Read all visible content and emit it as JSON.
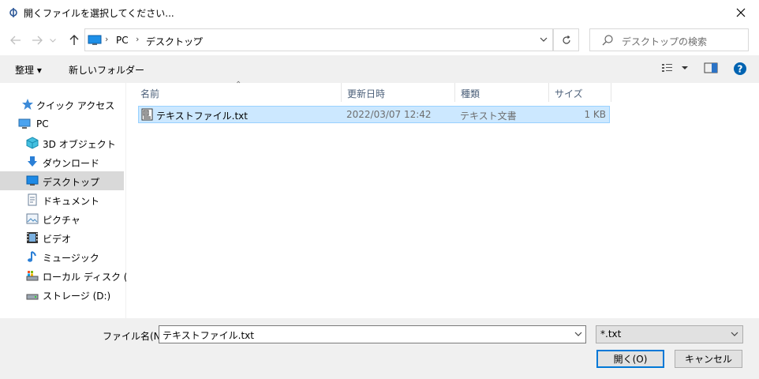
{
  "window": {
    "title": "開くファイルを選択してください..."
  },
  "address": {
    "crumbs": [
      "PC",
      "デスクトップ"
    ],
    "search_placeholder": "デスクトップの検索"
  },
  "toolbar": {
    "organize": "整理 ▾",
    "new_folder": "新しいフォルダー"
  },
  "sidebar": {
    "items": [
      {
        "label": "クイック アクセス",
        "icon": "star-icon"
      },
      {
        "label": "PC",
        "icon": "pc-icon"
      },
      {
        "label": "3D オブジェクト",
        "icon": "cube-icon"
      },
      {
        "label": "ダウンロード",
        "icon": "download-icon"
      },
      {
        "label": "デスクトップ",
        "icon": "desktop-icon",
        "selected": true
      },
      {
        "label": "ドキュメント",
        "icon": "document-icon"
      },
      {
        "label": "ピクチャ",
        "icon": "picture-icon"
      },
      {
        "label": "ビデオ",
        "icon": "video-icon"
      },
      {
        "label": "ミュージック",
        "icon": "music-icon"
      },
      {
        "label": "ローカル ディスク (C:)",
        "icon": "drive-icon"
      },
      {
        "label": "ストレージ (D:)",
        "icon": "drive-icon"
      }
    ]
  },
  "columns": {
    "name": "名前",
    "modified": "更新日時",
    "type": "種類",
    "size": "サイズ"
  },
  "files": [
    {
      "name": "テキストファイル.txt",
      "modified": "2022/03/07 12:42",
      "type": "テキスト文書",
      "size": "1 KB"
    }
  ],
  "bottom": {
    "filename_label": "ファイル名(N):",
    "filename_value": "テキストファイル.txt",
    "filetype_value": "*.txt",
    "open_button": "開く(O)",
    "cancel_button": "キャンセル"
  },
  "colors": {
    "selection_bg": "#cce8ff",
    "selection_border": "#99d1ff",
    "accent": "#0078d7"
  }
}
